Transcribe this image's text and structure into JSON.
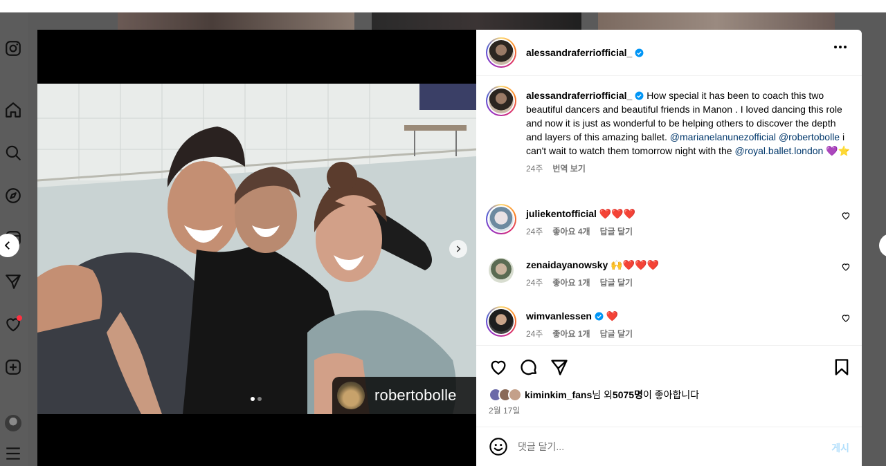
{
  "post": {
    "author": "alessandraferriofficial_",
    "caption": {
      "author": "alessandraferriofficial_",
      "text_1": "How special it has been to coach this two beautiful dancers and beautiful friends in Manon . I loved dancing this role and now it is just as wonderful to be helping others to discover the depth and layers of this amazing ballet.",
      "mention_1": "@marianelanunezofficial",
      "mention_2": "@robertobolle",
      "text_2": "i can't wait to watch them tomorrow night with the",
      "mention_3": "@royal.ballet.london",
      "emoji": "💜⭐",
      "time": "24주",
      "translate": "번역 보기"
    },
    "photo_tag": "robertobolle"
  },
  "comments": [
    {
      "user": "juliekentofficial",
      "text": "❤️❤️❤️",
      "time": "24주",
      "likes": "좋아요 4개",
      "reply": "답글 달기"
    },
    {
      "user": "zenaidayanowsky",
      "text": "🙌❤️❤️❤️",
      "time": "24주",
      "likes": "좋아요 1개",
      "reply": "답글 달기"
    },
    {
      "user": "wimvanlessen",
      "text": "❤️",
      "time": "24주",
      "likes": "좋아요 1개",
      "reply": "답글 달기"
    }
  ],
  "likes": {
    "user": "kiminkim_fans",
    "suffix": "님 외 ",
    "count": "5075명",
    "tail": "이 좋아합니다"
  },
  "date": "2월 17일",
  "add_comment": {
    "placeholder": "댓글 달기...",
    "post_label": "게시"
  },
  "colors": {
    "accent": "#0095f6",
    "mention": "#00376b",
    "verified": "#0095f6",
    "heart": "#ff3040"
  },
  "icons": [
    "instagram-icon",
    "home-icon",
    "search-icon",
    "explore-icon",
    "reels-icon",
    "messages-icon",
    "notifications-icon",
    "create-icon",
    "menu-icon",
    "heart-icon",
    "comment-icon",
    "share-icon",
    "save-icon",
    "emoji-icon"
  ]
}
